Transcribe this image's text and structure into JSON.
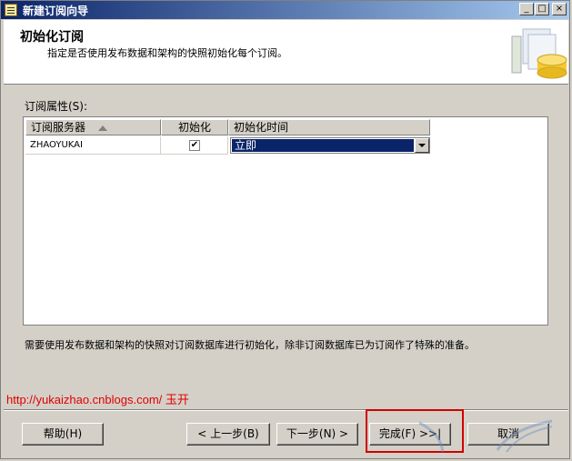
{
  "window": {
    "title": "新建订阅向导"
  },
  "title_buttons": {
    "minimize": "_",
    "maximize": "□",
    "close": "×"
  },
  "header": {
    "title": "初始化订阅",
    "subtitle": "指定是否使用发布数据和架构的快照初始化每个订阅。"
  },
  "grid": {
    "label": "订阅属性(S):",
    "columns": [
      "订阅服务器",
      "初始化",
      "初始化时间"
    ],
    "rows": [
      {
        "server": "ZHAOYUKAI",
        "initialize": true,
        "init_time": "立即"
      }
    ]
  },
  "hint": "需要使用发布数据和架构的快照对订阅数据库进行初始化，除非订阅数据库已为订阅作了特殊的准备。",
  "watermark": "http://yukaizhao.cnblogs.com/ 玉开",
  "buttons": {
    "help": "帮助(H)",
    "back": "< 上一步(B)",
    "next": "下一步(N) >",
    "finish": "完成(F) >>|",
    "cancel": "取消"
  },
  "colors": {
    "selection": "#0a246a",
    "highlight_box": "#d00000",
    "watermark": "#e00000"
  }
}
